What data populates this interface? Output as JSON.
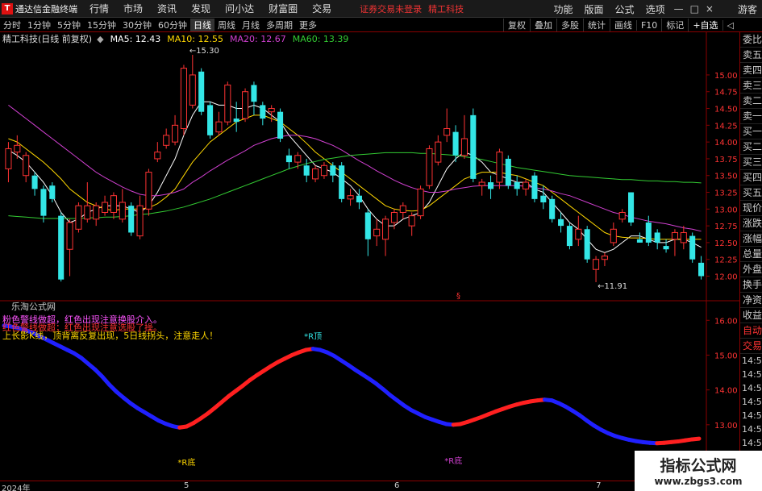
{
  "menubar": {
    "app_title": "通达信金融终端",
    "items": [
      "行情",
      "市场",
      "资讯",
      "发现",
      "问小达",
      "财富圈",
      "交易"
    ],
    "status": "证券交易未登录",
    "stock": "精工科技",
    "right_items": [
      "功能",
      "版面",
      "公式",
      "选项"
    ],
    "guest": "游客",
    "win_min": "—",
    "win_max": "□",
    "win_close": "×"
  },
  "periodbar": {
    "periods": [
      "分时",
      "1分钟",
      "5分钟",
      "15分钟",
      "30分钟",
      "60分钟",
      "日线",
      "周线",
      "月线",
      "多周期",
      "更多"
    ],
    "active": "日线",
    "tools": [
      "复权",
      "叠加",
      "多股",
      "统计",
      "画线",
      "F10",
      "标记",
      "+自选"
    ],
    "back_label": "◁"
  },
  "chart": {
    "stock_title": "精工科技(日线 前复权)",
    "ma_labels": [
      {
        "text": "MA5: 12.43",
        "color": "#ffffff"
      },
      {
        "text": "MA10: 12.55",
        "color": "#ffd700"
      },
      {
        "text": "MA20: 12.67",
        "color": "#d040d0"
      },
      {
        "text": "MA60: 13.39",
        "color": "#33cc33"
      }
    ],
    "high_label": "←15.30",
    "low_label": "←11.91",
    "marker": "§",
    "price_ticks": [
      "15.00",
      "14.75",
      "14.50",
      "14.25",
      "14.00",
      "13.75",
      "13.50",
      "13.25",
      "13.00",
      "12.75",
      "12.50",
      "12.25",
      "12.00"
    ],
    "colors": {
      "up": "#ff3333",
      "down": "#33e6e6",
      "ma5": "#ffffff",
      "ma10": "#ffd700",
      "ma20": "#d040d0",
      "ma60": "#33cc33"
    }
  },
  "chart_data": {
    "type": "candlestick",
    "ylim": [
      11.85,
      15.42
    ],
    "candles": [
      {
        "o": 13.6,
        "c": 13.9,
        "h": 14.0,
        "l": 13.4
      },
      {
        "o": 13.85,
        "c": 13.95,
        "h": 14.1,
        "l": 13.75
      },
      {
        "o": 13.5,
        "c": 13.8,
        "h": 13.85,
        "l": 13.4
      },
      {
        "o": 13.5,
        "c": 13.3,
        "h": 13.55,
        "l": 13.2
      },
      {
        "o": 13.3,
        "c": 12.9,
        "h": 13.35,
        "l": 12.8
      },
      {
        "o": 13.35,
        "c": 13.15,
        "h": 13.4,
        "l": 13.1
      },
      {
        "o": 12.9,
        "c": 11.95,
        "h": 12.95,
        "l": 11.92
      },
      {
        "o": 12.4,
        "c": 12.8,
        "h": 12.85,
        "l": 12.0
      },
      {
        "o": 12.7,
        "c": 13.05,
        "h": 13.1,
        "l": 12.65
      },
      {
        "o": 12.85,
        "c": 13.05,
        "h": 13.4,
        "l": 12.8
      },
      {
        "o": 12.85,
        "c": 13.05,
        "h": 13.1,
        "l": 12.75
      },
      {
        "o": 12.95,
        "c": 13.1,
        "h": 13.2,
        "l": 12.9
      },
      {
        "o": 12.95,
        "c": 13.2,
        "h": 13.25,
        "l": 12.85
      },
      {
        "o": 12.85,
        "c": 13.1,
        "h": 13.3,
        "l": 12.8
      },
      {
        "o": 13.05,
        "c": 12.65,
        "h": 13.1,
        "l": 12.6
      },
      {
        "o": 12.6,
        "c": 13.05,
        "h": 13.2,
        "l": 12.55
      },
      {
        "o": 13.0,
        "c": 13.55,
        "h": 13.6,
        "l": 12.9
      },
      {
        "o": 13.75,
        "c": 13.85,
        "h": 14.0,
        "l": 13.7
      },
      {
        "o": 13.95,
        "c": 14.1,
        "h": 14.2,
        "l": 13.9
      },
      {
        "o": 14.0,
        "c": 14.25,
        "h": 14.4,
        "l": 13.95
      },
      {
        "o": 14.2,
        "c": 15.1,
        "h": 15.15,
        "l": 14.1
      },
      {
        "o": 14.55,
        "c": 15.0,
        "h": 15.3,
        "l": 14.5
      },
      {
        "o": 15.05,
        "c": 14.45,
        "h": 15.1,
        "l": 14.4
      },
      {
        "o": 14.55,
        "c": 14.1,
        "h": 14.6,
        "l": 14.05
      },
      {
        "o": 14.15,
        "c": 14.3,
        "h": 14.45,
        "l": 14.1
      },
      {
        "o": 14.3,
        "c": 14.85,
        "h": 14.9,
        "l": 14.25
      },
      {
        "o": 14.35,
        "c": 14.3,
        "h": 14.6,
        "l": 14.15
      },
      {
        "o": 14.35,
        "c": 14.75,
        "h": 14.8,
        "l": 14.3
      },
      {
        "o": 14.85,
        "c": 14.6,
        "h": 14.9,
        "l": 14.4
      },
      {
        "o": 14.55,
        "c": 14.35,
        "h": 14.6,
        "l": 14.25
      },
      {
        "o": 14.45,
        "c": 14.5,
        "h": 14.55,
        "l": 14.3
      },
      {
        "o": 14.45,
        "c": 14.05,
        "h": 14.5,
        "l": 14.0
      },
      {
        "o": 13.8,
        "c": 13.7,
        "h": 13.9,
        "l": 13.6
      },
      {
        "o": 13.7,
        "c": 13.8,
        "h": 13.85,
        "l": 13.6
      },
      {
        "o": 13.65,
        "c": 13.5,
        "h": 13.75,
        "l": 13.4
      },
      {
        "o": 13.45,
        "c": 13.6,
        "h": 13.65,
        "l": 13.4
      },
      {
        "o": 13.5,
        "c": 13.65,
        "h": 13.7,
        "l": 13.45
      },
      {
        "o": 13.65,
        "c": 13.5,
        "h": 13.7,
        "l": 13.4
      },
      {
        "o": 13.65,
        "c": 13.15,
        "h": 13.7,
        "l": 13.1
      },
      {
        "o": 13.15,
        "c": 13.2,
        "h": 13.3,
        "l": 13.05
      },
      {
        "o": 13.2,
        "c": 13.1,
        "h": 13.3,
        "l": 13.0
      },
      {
        "o": 12.95,
        "c": 12.55,
        "h": 13.0,
        "l": 12.3
      },
      {
        "o": 12.6,
        "c": 12.7,
        "h": 12.85,
        "l": 12.45
      },
      {
        "o": 12.55,
        "c": 12.85,
        "h": 12.9,
        "l": 12.3
      },
      {
        "o": 12.8,
        "c": 12.95,
        "h": 13.0,
        "l": 12.7
      },
      {
        "o": 12.95,
        "c": 13.05,
        "h": 13.1,
        "l": 12.85
      },
      {
        "o": 12.75,
        "c": 12.9,
        "h": 12.95,
        "l": 12.6
      },
      {
        "o": 12.9,
        "c": 13.3,
        "h": 13.35,
        "l": 12.85
      },
      {
        "o": 13.35,
        "c": 13.9,
        "h": 13.95,
        "l": 13.3
      },
      {
        "o": 13.7,
        "c": 14.0,
        "h": 14.1,
        "l": 13.65
      },
      {
        "o": 14.1,
        "c": 14.2,
        "h": 14.5,
        "l": 14.0
      },
      {
        "o": 14.15,
        "c": 13.8,
        "h": 14.25,
        "l": 13.7
      },
      {
        "o": 13.8,
        "c": 14.05,
        "h": 14.4,
        "l": 13.75
      },
      {
        "o": 14.4,
        "c": 13.45,
        "h": 14.5,
        "l": 13.4
      },
      {
        "o": 13.35,
        "c": 13.4,
        "h": 13.45,
        "l": 13.2
      },
      {
        "o": 13.4,
        "c": 13.3,
        "h": 13.5,
        "l": 13.15
      },
      {
        "o": 13.4,
        "c": 13.85,
        "h": 13.9,
        "l": 13.3
      },
      {
        "o": 13.75,
        "c": 13.35,
        "h": 13.8,
        "l": 13.3
      },
      {
        "o": 13.4,
        "c": 13.3,
        "h": 13.5,
        "l": 13.2
      },
      {
        "o": 13.3,
        "c": 13.4,
        "h": 13.45,
        "l": 13.2
      },
      {
        "o": 13.5,
        "c": 13.15,
        "h": 13.55,
        "l": 13.1
      },
      {
        "o": 13.2,
        "c": 13.1,
        "h": 13.35,
        "l": 13.0
      },
      {
        "o": 13.15,
        "c": 12.85,
        "h": 13.2,
        "l": 12.8
      },
      {
        "o": 12.85,
        "c": 12.75,
        "h": 12.95,
        "l": 12.65
      },
      {
        "o": 12.75,
        "c": 12.45,
        "h": 12.8,
        "l": 12.4
      },
      {
        "o": 12.55,
        "c": 12.7,
        "h": 12.9,
        "l": 12.45
      },
      {
        "o": 12.7,
        "c": 12.25,
        "h": 12.75,
        "l": 12.2
      },
      {
        "o": 12.1,
        "c": 12.25,
        "h": 12.3,
        "l": 11.91
      },
      {
        "o": 12.25,
        "c": 12.3,
        "h": 12.35,
        "l": 12.15
      },
      {
        "o": 12.5,
        "c": 12.7,
        "h": 12.8,
        "l": 12.45
      },
      {
        "o": 12.85,
        "c": 12.95,
        "h": 13.0,
        "l": 12.8
      },
      {
        "o": 13.25,
        "c": 12.8,
        "h": 13.25,
        "l": 12.75
      },
      {
        "o": 12.55,
        "c": 12.5,
        "h": 12.65,
        "l": 12.5
      },
      {
        "o": 12.8,
        "c": 12.5,
        "h": 12.9,
        "l": 12.45
      },
      {
        "o": 12.65,
        "c": 12.5,
        "h": 12.7,
        "l": 12.4
      },
      {
        "o": 12.45,
        "c": 12.4,
        "h": 12.55,
        "l": 12.35
      },
      {
        "o": 12.55,
        "c": 12.65,
        "h": 12.7,
        "l": 12.3
      },
      {
        "o": 12.5,
        "c": 12.65,
        "h": 12.75,
        "l": 12.4
      },
      {
        "o": 12.6,
        "c": 12.25,
        "h": 12.65,
        "l": 12.2
      },
      {
        "o": 12.2,
        "c": 12.0,
        "h": 12.3,
        "l": 11.95
      }
    ],
    "ma_lines": {
      "MA5": [
        13.88,
        13.8,
        13.7,
        13.55,
        13.4,
        13.2,
        12.95,
        12.8,
        12.85,
        12.95,
        13.0,
        13.05,
        13.05,
        13.05,
        13.0,
        12.95,
        13.05,
        13.25,
        13.5,
        13.75,
        14.1,
        14.4,
        14.6,
        14.6,
        14.55,
        14.55,
        14.5,
        14.5,
        14.55,
        14.5,
        14.4,
        14.3,
        14.1,
        13.95,
        13.8,
        13.65,
        13.6,
        13.55,
        13.45,
        13.35,
        13.2,
        13.0,
        12.85,
        12.75,
        12.75,
        12.85,
        12.9,
        12.95,
        13.1,
        13.35,
        13.6,
        13.75,
        13.85,
        13.8,
        13.7,
        13.55,
        13.5,
        13.45,
        13.4,
        13.4,
        13.3,
        13.25,
        13.1,
        12.95,
        12.8,
        12.7,
        12.55,
        12.4,
        12.35,
        12.4,
        12.5,
        12.6,
        12.6,
        12.55,
        12.5,
        12.5,
        12.55,
        12.55,
        12.5,
        12.43
      ],
      "MA10": [
        14.05,
        14.0,
        13.9,
        13.8,
        13.7,
        13.58,
        13.45,
        13.3,
        13.2,
        13.1,
        13.05,
        13.0,
        12.98,
        13.0,
        13.0,
        13.0,
        13.02,
        13.08,
        13.18,
        13.3,
        13.5,
        13.7,
        13.85,
        14.0,
        14.1,
        14.2,
        14.3,
        14.35,
        14.4,
        14.4,
        14.35,
        14.3,
        14.2,
        14.1,
        13.98,
        13.85,
        13.75,
        13.65,
        13.55,
        13.45,
        13.35,
        13.25,
        13.15,
        13.05,
        13.0,
        12.98,
        12.97,
        12.98,
        13.05,
        13.15,
        13.25,
        13.35,
        13.45,
        13.5,
        13.55,
        13.55,
        13.55,
        13.52,
        13.5,
        13.45,
        13.4,
        13.35,
        13.25,
        13.15,
        13.05,
        12.95,
        12.85,
        12.75,
        12.65,
        12.6,
        12.58,
        12.57,
        12.57,
        12.56,
        12.55,
        12.55,
        12.55,
        12.55,
        12.55,
        12.55
      ],
      "MA20": [
        14.55,
        14.45,
        14.35,
        14.25,
        14.15,
        14.05,
        13.95,
        13.85,
        13.75,
        13.65,
        13.55,
        13.47,
        13.4,
        13.33,
        13.27,
        13.22,
        13.2,
        13.2,
        13.22,
        13.25,
        13.3,
        13.4,
        13.48,
        13.57,
        13.65,
        13.73,
        13.8,
        13.87,
        13.95,
        14.0,
        14.05,
        14.08,
        14.1,
        14.1,
        14.08,
        14.05,
        14.0,
        13.95,
        13.88,
        13.8,
        13.72,
        13.65,
        13.57,
        13.5,
        13.43,
        13.37,
        13.32,
        13.28,
        13.25,
        13.25,
        13.27,
        13.3,
        13.32,
        13.34,
        13.35,
        13.35,
        13.35,
        13.35,
        13.35,
        13.34,
        13.32,
        13.3,
        13.27,
        13.23,
        13.2,
        13.15,
        13.1,
        13.05,
        13.0,
        12.95,
        12.92,
        12.88,
        12.85,
        12.82,
        12.8,
        12.78,
        12.75,
        12.72,
        12.7,
        12.67
      ],
      "MA60": [
        12.9,
        12.89,
        12.88,
        12.87,
        12.86,
        12.86,
        12.86,
        12.86,
        12.86,
        12.87,
        12.87,
        12.88,
        12.88,
        12.89,
        12.9,
        12.92,
        12.93,
        12.95,
        12.97,
        13.0,
        13.03,
        13.07,
        13.11,
        13.15,
        13.2,
        13.25,
        13.3,
        13.35,
        13.4,
        13.45,
        13.5,
        13.55,
        13.6,
        13.64,
        13.68,
        13.71,
        13.74,
        13.76,
        13.78,
        13.8,
        13.81,
        13.82,
        13.83,
        13.84,
        13.84,
        13.84,
        13.84,
        13.83,
        13.83,
        13.82,
        13.81,
        13.8,
        13.78,
        13.76,
        13.74,
        13.71,
        13.68,
        13.65,
        13.62,
        13.6,
        13.58,
        13.56,
        13.54,
        13.52,
        13.5,
        13.49,
        13.48,
        13.47,
        13.46,
        13.45,
        13.44,
        13.44,
        13.43,
        13.42,
        13.42,
        13.41,
        13.41,
        13.4,
        13.4,
        13.39
      ]
    },
    "indicator": {
      "ylim": [
        12.0,
        16.4
      ],
      "ticks": [
        "16.00",
        "15.00",
        "14.00",
        "13.00",
        "12.00"
      ],
      "line": [
        15.85,
        15.82,
        15.78,
        15.72,
        15.65,
        15.55,
        15.45,
        15.35,
        15.25,
        15.15,
        15.05,
        14.92,
        14.75,
        14.58,
        14.38,
        14.15,
        13.95,
        13.78,
        13.62,
        13.48,
        13.36,
        13.24,
        13.12,
        13.03,
        12.96,
        12.92,
        12.95,
        13.05,
        13.18,
        13.32,
        13.48,
        13.65,
        13.82,
        13.97,
        14.12,
        14.28,
        14.42,
        14.55,
        14.68,
        14.8,
        14.9,
        15.0,
        15.08,
        15.15,
        15.18,
        15.15,
        15.08,
        14.98,
        14.85,
        14.72,
        14.58,
        14.45,
        14.32,
        14.18,
        14.02,
        13.85,
        13.7,
        13.55,
        13.42,
        13.32,
        13.22,
        13.15,
        13.08,
        13.02,
        13.0,
        13.02,
        13.08,
        13.15,
        13.22,
        13.3,
        13.38,
        13.45,
        13.52,
        13.58,
        13.63,
        13.67,
        13.7,
        13.72,
        13.7,
        13.62,
        13.52,
        13.4,
        13.27,
        13.12,
        12.98,
        12.86,
        12.76,
        12.68,
        12.62,
        12.57,
        12.53,
        12.5,
        12.48,
        12.47,
        12.48,
        12.5,
        12.52,
        12.55,
        12.58,
        12.6
      ],
      "up_color": "#ff2020",
      "down_color": "#2020ff",
      "labels": [
        {
          "text": "*R底",
          "color": "#ffd700",
          "at": 26,
          "pos": "below"
        },
        {
          "text": "*R顶",
          "color": "#33e6e6",
          "at": 44,
          "pos": "above"
        },
        {
          "text": "*R底",
          "color": "#d040d0",
          "at": 64,
          "pos": "below"
        },
        {
          "text": "*R底",
          "color": "#ffd700",
          "at": 94,
          "pos": "below"
        }
      ]
    }
  },
  "indicator": {
    "name": "乐淘公式网",
    "alert_lines": [
      {
        "text": "粉色警线做超，红色出现注意换股介入。",
        "color": "#ff55ff"
      },
      {
        "text": "红色警线做超；红色出现注意选股了操。",
        "color": "#ff3333"
      },
      {
        "text": "上长影K线，顶背离反复出现，5日线拐头，注意走人！",
        "color": "#ffd700"
      }
    ]
  },
  "rightpanel": {
    "items": [
      "委比",
      "卖五",
      "卖四",
      "卖三",
      "卖二",
      "卖一",
      "买一",
      "买二",
      "买三",
      "买四",
      "买五",
      "现价",
      "涨跌",
      "涨幅",
      "总量",
      "外盘",
      "换手",
      "净资",
      "收益",
      "自动",
      "交易"
    ],
    "times": [
      "14:56",
      "14:56",
      "14:56",
      "14:56",
      "14:56",
      "14:56",
      "14:56",
      "14:56",
      "14:56",
      "14:56"
    ]
  },
  "dateaxis": {
    "labels": [
      {
        "text": "2024年",
        "at": 0
      },
      {
        "text": "5",
        "at": 20
      },
      {
        "text": "6",
        "at": 44
      },
      {
        "text": "7",
        "at": 67
      }
    ]
  },
  "watermark": {
    "title": "指标公式网",
    "url": "www.zbgs3.com"
  }
}
